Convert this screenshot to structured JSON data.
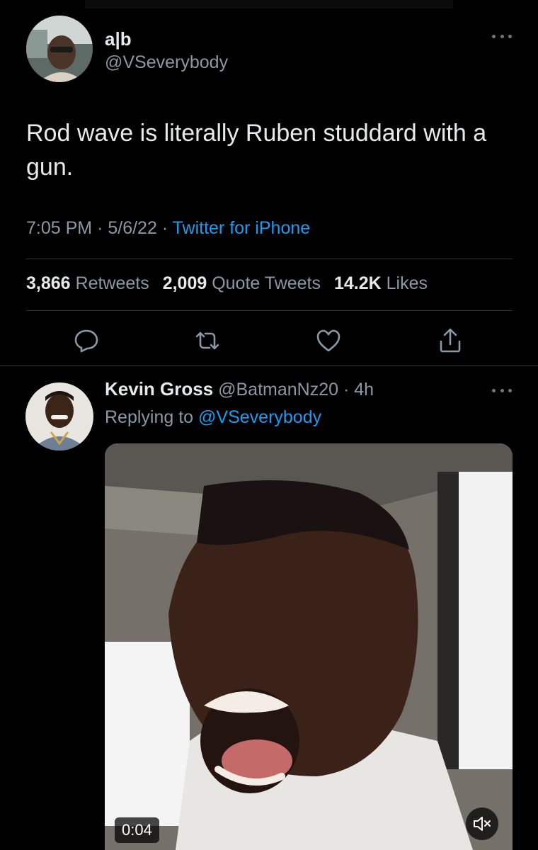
{
  "tweet": {
    "author_name": "a|b",
    "author_handle": "@VSeverybody",
    "text": "Rod wave is literally Ruben studdard with a gun.",
    "time": "7:05 PM",
    "date": "5/6/22",
    "source": "Twitter for iPhone",
    "separator": "·",
    "stats": {
      "retweets_count": "3,866",
      "retweets_label": "Retweets",
      "quotes_count": "2,009",
      "quotes_label": "Quote Tweets",
      "likes_count": "14.2K",
      "likes_label": "Likes"
    },
    "actions": [
      "reply-icon",
      "retweet-icon",
      "like-icon",
      "share-icon"
    ]
  },
  "reply": {
    "author_name": "Kevin Gross",
    "author_handle": "@BatmanNz20",
    "age": "4h",
    "replying_prefix": "Replying to",
    "replying_to": "@VSeverybody",
    "video": {
      "duration": "0:04",
      "muted_icon": "muted-speaker-icon"
    }
  },
  "colors": {
    "background": "#000000",
    "text": "#e7e9ea",
    "secondary": "#8b98a5",
    "accent": "#1d9bf0",
    "divider": "#2f3336"
  }
}
